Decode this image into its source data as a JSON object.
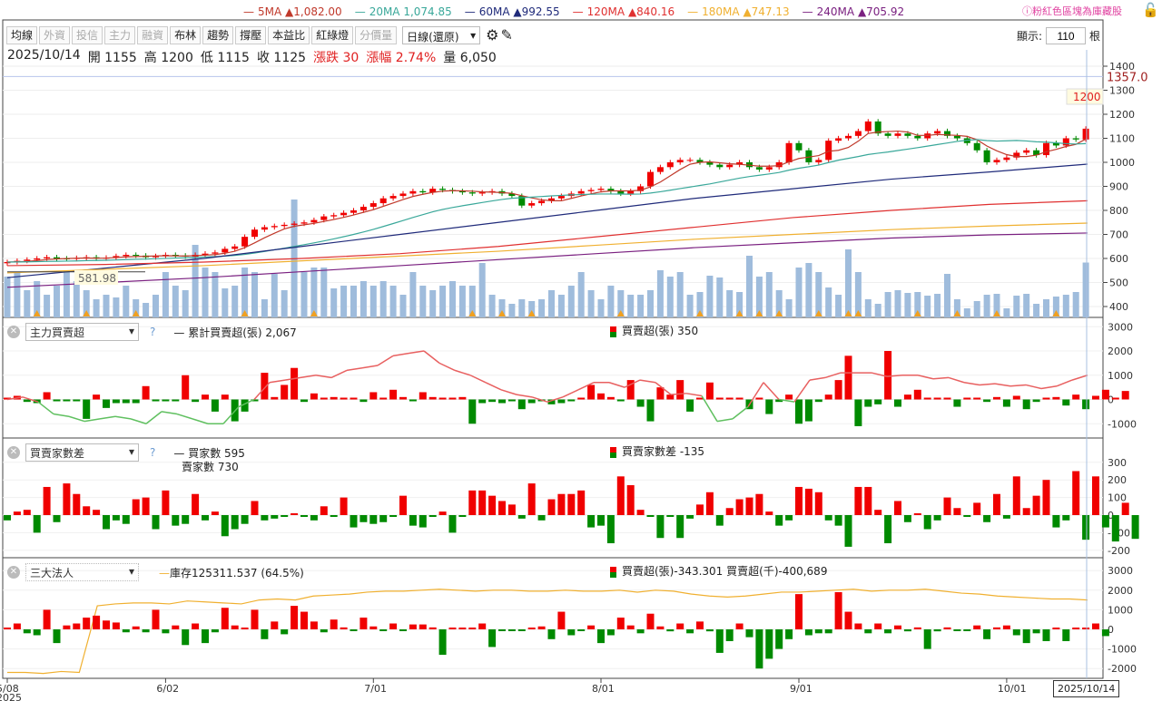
{
  "legend": [
    {
      "label": "5MA ▲1,082.00",
      "color": "#c0392b"
    },
    {
      "label": "20MA 1,074.85",
      "color": "#3aa89a"
    },
    {
      "label": "60MA ▲992.55",
      "color": "#1f2a7a"
    },
    {
      "label": "120MA ▲840.16",
      "color": "#e03030"
    },
    {
      "label": "180MA ▲747.13",
      "color": "#f0b030"
    },
    {
      "label": "240MA ▲705.92",
      "color": "#7a2080"
    }
  ],
  "notice": "ⓘ粉紅色區塊為庫藏股",
  "toolbar": {
    "buttons": [
      {
        "label": "均線",
        "enabled": true
      },
      {
        "label": "外資",
        "enabled": false
      },
      {
        "label": "投信",
        "enabled": false
      },
      {
        "label": "主力",
        "enabled": false
      },
      {
        "label": "融資",
        "enabled": false
      },
      {
        "label": "布林",
        "enabled": true
      },
      {
        "label": "趨勢",
        "enabled": true
      },
      {
        "label": "撐壓",
        "enabled": true
      },
      {
        "label": "本益比",
        "enabled": true
      },
      {
        "label": "紅綠燈",
        "enabled": true
      },
      {
        "label": "分價量",
        "enabled": false
      }
    ],
    "period": "日線(還原)",
    "show_label": "顯示:",
    "show_value": "110",
    "show_unit": "根"
  },
  "info": {
    "date": "2025/10/14",
    "open": "開 1155",
    "high": "高 1200",
    "low": "低 1115",
    "close": "收 1125",
    "change": "漲跌 30",
    "pct": "漲幅 2.74%",
    "volume": "量 6,050"
  },
  "price_axis": {
    "ticks": [
      1400,
      1300,
      1200,
      1100,
      1000,
      900,
      800,
      700,
      600,
      500,
      400
    ],
    "ref_line": "1357.0",
    "ref_value": 1357,
    "high_tag": "1200",
    "low_tag": "581.98",
    "low_value": 581.98
  },
  "dates": {
    "ticks": [
      {
        "label": "5/08",
        "i": 0
      },
      {
        "label": "6/02",
        "i": 16
      },
      {
        "label": "7/01",
        "i": 37
      },
      {
        "label": "8/01",
        "i": 60
      },
      {
        "label": "9/01",
        "i": 80
      },
      {
        "label": "10/01",
        "i": 101
      }
    ],
    "year": "2025",
    "current": "2025/10/14"
  },
  "closes": [
    585,
    590,
    595,
    600,
    605,
    600,
    598,
    602,
    605,
    600,
    603,
    610,
    615,
    612,
    605,
    610,
    615,
    612,
    608,
    615,
    620,
    625,
    640,
    650,
    690,
    720,
    730,
    735,
    740,
    745,
    750,
    760,
    775,
    780,
    790,
    800,
    815,
    830,
    850,
    860,
    870,
    880,
    875,
    890,
    885,
    880,
    875,
    870,
    875,
    880,
    870,
    860,
    820,
    830,
    840,
    850,
    860,
    870,
    880,
    885,
    890,
    880,
    870,
    880,
    900,
    960,
    980,
    1000,
    1010,
    1010,
    1000,
    990,
    980,
    990,
    1000,
    980,
    970,
    980,
    1000,
    1080,
    1050,
    1000,
    1010,
    1090,
    1100,
    1110,
    1130,
    1170,
    1120,
    1110,
    1120,
    1110,
    1100,
    1120,
    1130,
    1110,
    1100,
    1080,
    1050,
    1000,
    1010,
    1020,
    1040,
    1050,
    1030,
    1080,
    1070,
    1100,
    1095,
    1140
  ],
  "volumes": [
    4500,
    5000,
    3000,
    4000,
    2500,
    3500,
    5200,
    4000,
    3000,
    2000,
    2500,
    2200,
    3500,
    2000,
    1600,
    2500,
    5000,
    3500,
    3000,
    8000,
    5500,
    5000,
    3200,
    3500,
    5500,
    5000,
    2000,
    4800,
    3000,
    13000,
    5000,
    5500,
    5500,
    3200,
    3500,
    3500,
    4000,
    3500,
    4000,
    3500,
    2500,
    5000,
    3500,
    3000,
    3500,
    4000,
    3500,
    3500,
    6000,
    2500,
    2000,
    1500,
    2000,
    1800,
    2000,
    3000,
    2500,
    3500,
    5000,
    3000,
    2000,
    3500,
    3000,
    2500,
    2500,
    3000,
    5200,
    4500,
    5000,
    2500,
    2800,
    4600,
    4400,
    3000,
    2800,
    6800,
    4500,
    5000,
    3000,
    2000,
    5500,
    6000,
    5000,
    3300,
    2500,
    7500,
    5000,
    2000,
    1500,
    2800,
    3000,
    2700,
    2800,
    2400,
    2600,
    4800,
    2000,
    1000,
    1800,
    2500,
    2600,
    1000,
    2400,
    2600,
    1500,
    2000,
    2300,
    2500,
    2800,
    6050
  ],
  "ma_long": {
    "ma60": [
      520,
      560,
      600,
      650,
      700,
      750,
      800,
      850,
      890,
      930,
      960,
      992.55
    ],
    "ma120": [
      570,
      575,
      585,
      600,
      620,
      650,
      690,
      730,
      770,
      800,
      825,
      840.16
    ],
    "ma180": [
      540,
      555,
      570,
      590,
      610,
      630,
      655,
      680,
      700,
      720,
      735,
      747.13
    ],
    "ma240": [
      480,
      500,
      520,
      545,
      570,
      595,
      620,
      645,
      665,
      685,
      698,
      705.92
    ]
  },
  "markers": [
    3,
    8,
    13,
    24,
    31,
    47,
    50,
    53,
    62,
    70,
    74,
    76,
    78,
    82,
    85,
    86,
    92,
    96,
    100,
    106
  ],
  "panels": [
    {
      "selector": "主力買賣超",
      "help": "?",
      "line_label": "累計買賣超(張) 2,067",
      "bar_label": "買賣超(張) 350",
      "ticks": [
        3000,
        2000,
        1000,
        0,
        -1000
      ],
      "bars": [
        0,
        150,
        -100,
        -150,
        300,
        -50,
        -50,
        -50,
        -800,
        200,
        -350,
        -150,
        -150,
        -150,
        550,
        -30,
        -30,
        -30,
        1000,
        -100,
        200,
        -500,
        200,
        -900,
        -500,
        -30,
        1100,
        100,
        600,
        1300,
        -100,
        250,
        0,
        100,
        50,
        0,
        -100,
        300,
        0,
        400,
        100,
        -50,
        300,
        100,
        0,
        0,
        100,
        -1000,
        -150,
        -100,
        -150,
        -50,
        -400,
        -150,
        -50,
        -200,
        -150,
        -30,
        0,
        600,
        250,
        100,
        -60,
        800,
        -300,
        -900,
        500,
        200,
        800,
        -500,
        0,
        700,
        0,
        0,
        0,
        -400,
        0,
        -600,
        -100,
        200,
        -1000,
        -900,
        -100,
        200,
        800,
        1800,
        -1100,
        -300,
        -200,
        2000,
        -300,
        200,
        400,
        0,
        0,
        0,
        -300,
        50,
        0,
        -100,
        100,
        -300,
        150,
        -400,
        -100,
        0,
        100,
        -250,
        200,
        -400,
        150,
        400,
        0,
        350
      ],
      "line": [
        0,
        100,
        -100,
        -600,
        -700,
        -900,
        -800,
        -700,
        -800,
        -1000,
        -500,
        -600,
        -800,
        -1000,
        -1000,
        -300,
        0,
        700,
        800,
        900,
        1000,
        900,
        1200,
        1300,
        1400,
        1800,
        1900,
        2000,
        1500,
        1200,
        1000,
        700,
        400,
        200,
        100,
        -100,
        100,
        400,
        700,
        700,
        500,
        800,
        700,
        200,
        250,
        150,
        -900,
        -800,
        -300,
        700,
        0,
        -100,
        800,
        900,
        1100,
        1100,
        1100,
        950,
        1000,
        1000,
        850,
        900,
        700,
        600,
        650,
        550,
        600,
        450,
        550,
        800,
        1000
      ]
    },
    {
      "selector": "買賣家數差",
      "help": "?",
      "line_label": "買家數 595",
      "line_label2": "賣家數 730",
      "bar_label": "買賣家數差 -135",
      "ticks": [
        300,
        200,
        100,
        0,
        -100,
        -200
      ],
      "bars": [
        -30,
        20,
        30,
        -100,
        160,
        -40,
        180,
        120,
        50,
        30,
        -80,
        -30,
        -50,
        90,
        100,
        -80,
        140,
        -60,
        -50,
        120,
        -30,
        20,
        -120,
        -80,
        -50,
        80,
        -30,
        -20,
        -10,
        10,
        -10,
        -30,
        50,
        -10,
        100,
        -70,
        -40,
        -50,
        -40,
        -10,
        110,
        -60,
        -70,
        -10,
        20,
        -100,
        -10,
        140,
        140,
        110,
        80,
        60,
        -20,
        180,
        -30,
        90,
        120,
        120,
        140,
        -70,
        -60,
        -160,
        220,
        170,
        30,
        -10,
        -130,
        -10,
        -130,
        -20,
        60,
        130,
        -60,
        40,
        90,
        100,
        120,
        20,
        -60,
        -30,
        160,
        150,
        130,
        -30,
        -60,
        -180,
        160,
        160,
        30,
        -160,
        80,
        -40,
        10,
        -80,
        -30,
        100,
        40,
        -10,
        70,
        -40,
        120,
        -20,
        220,
        40,
        110,
        200,
        -70,
        -30,
        250,
        -140,
        220,
        -70,
        -150,
        70,
        -135
      ]
    },
    {
      "selector": "三大法人",
      "line_label": "庫存125311.537 (64.5%)",
      "bar_label": "買賣超(張)-343.301 買賣超(千)-400,689",
      "ticks": [
        3000,
        2000,
        1000,
        0,
        -1000,
        -2000
      ],
      "bars": [
        0,
        300,
        -200,
        -300,
        1000,
        -700,
        200,
        300,
        600,
        700,
        450,
        350,
        -150,
        150,
        -150,
        1000,
        -200,
        200,
        -800,
        300,
        -700,
        -150,
        1100,
        200,
        50,
        1000,
        -500,
        400,
        -250,
        1200,
        900,
        400,
        -150,
        500,
        100,
        -50,
        600,
        150,
        -20,
        300,
        -50,
        250,
        250,
        100,
        -1300,
        50,
        50,
        50,
        300,
        -900,
        -50,
        -20,
        -10,
        50,
        150,
        -500,
        900,
        -300,
        -50,
        200,
        -700,
        -300,
        600,
        200,
        -200,
        800,
        150,
        -100,
        300,
        -200,
        400,
        -100,
        -1200,
        -600,
        300,
        -400,
        -2000,
        -1500,
        -1000,
        -500,
        1800,
        -300,
        -200,
        -200,
        1900,
        900,
        300,
        -200,
        300,
        -200,
        200,
        -100,
        100,
        -1000,
        -100,
        100,
        -50,
        -50,
        200,
        -500,
        100,
        200,
        -300,
        -700,
        -200,
        -600,
        0,
        -600,
        0,
        0,
        300,
        -343
      ],
      "line": [
        -2200,
        -2200,
        -2250,
        -2150,
        -2200,
        1200,
        1300,
        1350,
        1350,
        1300,
        1450,
        1400,
        1350,
        1300,
        1500,
        1550,
        1500,
        1700,
        1750,
        1800,
        1900,
        1950,
        1950,
        2000,
        2050,
        2000,
        1950,
        2000,
        2000,
        1950,
        1950,
        2000,
        1950,
        1950,
        2000,
        1900,
        2000,
        1950,
        1800,
        1700,
        1650,
        1700,
        1800,
        1900,
        1900,
        1950,
        2000,
        2050,
        1950,
        2000,
        2000,
        2050,
        1950,
        1850,
        1800,
        1700,
        1650,
        1600,
        1550,
        1550,
        1500
      ]
    }
  ]
}
